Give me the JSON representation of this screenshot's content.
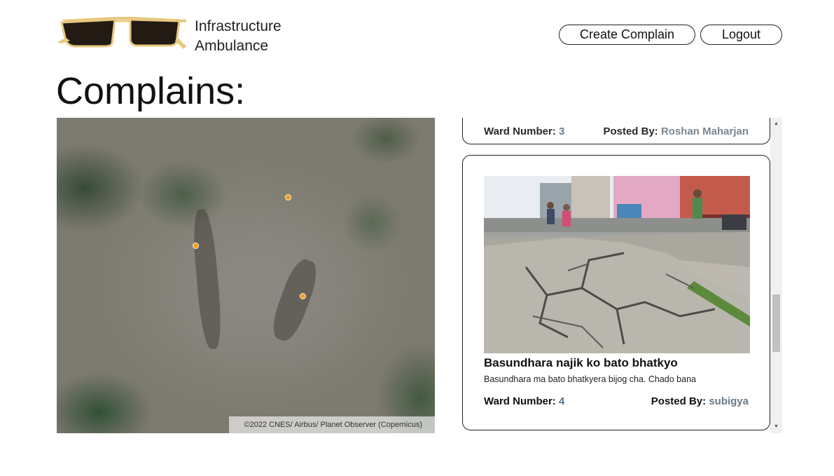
{
  "header": {
    "brand_line1": "Infrastructure",
    "brand_line2": "Ambulance",
    "logo_icon": "sunglasses-logo-icon",
    "create_label": "Create Complain",
    "logout_label": "Logout"
  },
  "page": {
    "title": "Complains:"
  },
  "map": {
    "attribution": "©2022 CNES/ Airbus/ Planet Observer (Copernicus)",
    "marker_color": "#f0a020"
  },
  "feed": {
    "previous_card": {
      "ward_label": "Ward Number:",
      "ward_value": "3",
      "posted_label": "Posted By:",
      "posted_value": "Roshan Maharjan"
    },
    "card": {
      "image_icon": "damaged-road-photo",
      "title": "Basundhara najik ko bato bhatkyo",
      "description": "Basundhara ma bato bhatkyera bijog cha. Chado bana",
      "ward_label": "Ward Number:",
      "ward_value": "4",
      "posted_label": "Posted By:",
      "posted_value": "subigya"
    }
  },
  "colors": {
    "border": "#222222",
    "muted_value": "#6a7a86"
  }
}
